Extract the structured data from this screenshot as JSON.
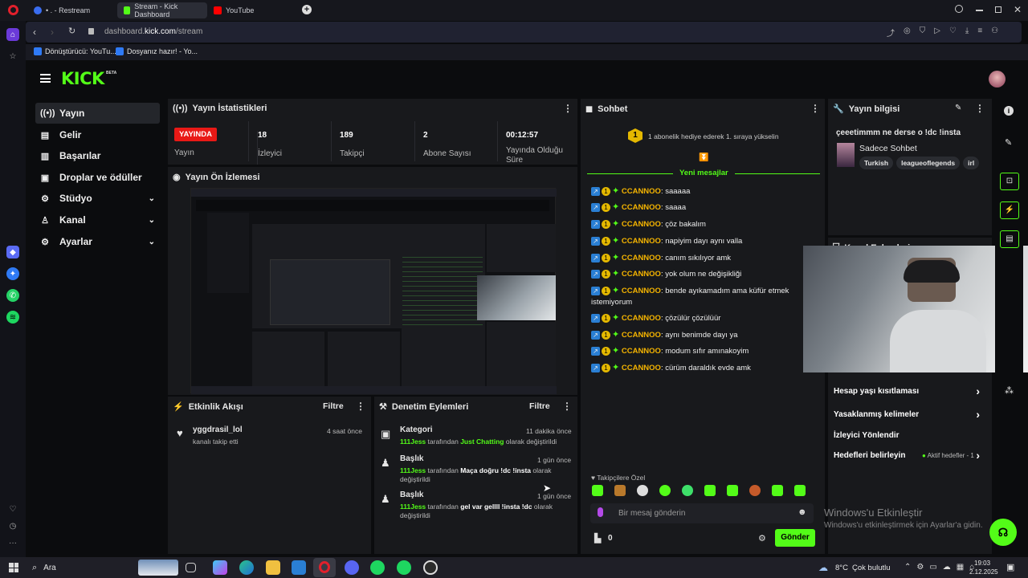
{
  "browser": {
    "tabs": [
      {
        "label": "• . - Restream"
      },
      {
        "label": "Stream - Kick Dashboard"
      },
      {
        "label": "YouTube"
      }
    ],
    "url_prefix": "dashboard.",
    "url_domain": "kick.com",
    "url_path": "/stream",
    "bookmarks": [
      {
        "label": "Dönüştürücü: YouTu..."
      },
      {
        "label": "Dosyanız hazır! - Yo..."
      }
    ]
  },
  "kick": {
    "logo": "KICK",
    "logo_beta": "BETA",
    "nav": [
      {
        "label": "Yayın"
      },
      {
        "label": "Gelir"
      },
      {
        "label": "Başarılar"
      },
      {
        "label": "Droplar ve ödüller"
      },
      {
        "label": "Stüdyo"
      },
      {
        "label": "Kanal"
      },
      {
        "label": "Ayarlar"
      }
    ],
    "stats": {
      "title": "Yayın İstatistikleri",
      "live_badge": "YAYINDA",
      "items": [
        {
          "value": "",
          "label": "Yayın"
        },
        {
          "value": "18",
          "label": "İzleyici"
        },
        {
          "value": "189",
          "label": "Takipçi"
        },
        {
          "value": "2",
          "label": "Abone Sayısı"
        },
        {
          "value": "00:12:57",
          "label": "Yayında Olduğu Süre"
        }
      ]
    },
    "preview": {
      "title": "Yayın Ön İzlemesi"
    },
    "activity": {
      "title": "Etkinlik Akışı",
      "filter": "Filtre",
      "items": [
        {
          "user": "yggdrasil_lol",
          "text": "kanalı takip etti",
          "time": "4 saat önce"
        }
      ]
    },
    "moderation": {
      "title": "Denetim Eylemleri",
      "filter": "Filtre",
      "items": [
        {
          "title": "Kategori",
          "time": "11 dakika önce",
          "user": "111Jess",
          "mid": "tarafından",
          "value": "Just Chatting",
          "suffix": "olarak değiştirildi"
        },
        {
          "title": "Başlık",
          "time": "1 gün önce",
          "user": "111Jess",
          "mid": "tarafından",
          "value": "Maça doğru !dc !insta",
          "suffix": "olarak değiştirildi"
        },
        {
          "title": "Başlık",
          "time": "1 gün önce",
          "user": "111Jess",
          "mid": "tarafından",
          "value": "gel var gellll !insta !dc",
          "suffix": "olarak değiştirildi"
        }
      ]
    },
    "chat": {
      "title": "Sohbet",
      "pinned": "1 abonelik hediye ederek 1. sıraya yükselin",
      "new_messages": "Yeni mesajlar",
      "messages": [
        {
          "user": "CCANNOO",
          "text": "saaaaa"
        },
        {
          "user": "CCANNOO",
          "text": "saaaa"
        },
        {
          "user": "CCANNOO",
          "text": "çöz bakalım"
        },
        {
          "user": "CCANNOO",
          "text": "napiyim dayı aynı valla"
        },
        {
          "user": "CCANNOO",
          "text": "canım sıkılıyor amk"
        },
        {
          "user": "CCANNOO",
          "text": "yok olum ne değişikliği"
        },
        {
          "user": "CCANNOO",
          "text": "bende ayıkamadım ama küfür etmek istemiyorum"
        },
        {
          "user": "CCANNOO",
          "text": "çözülür çözülüür"
        },
        {
          "user": "CCANNOO",
          "text": "aynı benimde dayı ya"
        },
        {
          "user": "CCANNOO",
          "text": "modum sıfır amınakoyim"
        },
        {
          "user": "CCANNOO",
          "text": "cürüm daraldık evde amk"
        }
      ],
      "followers_label": "Takipçilere Özel",
      "input_placeholder": "Bir mesaj gönderin",
      "points": "0",
      "send": "Gönder"
    },
    "stream_info": {
      "title": "Yayın bilgisi",
      "stream_title": "çeeetimmm ne derse o !dc !insta",
      "category": "Sadece Sohbet",
      "tags": [
        "Turkish",
        "leagueoflegends",
        "irl"
      ],
      "channel_actions": "Kanal Eylemleri",
      "actions": [
        {
          "label": "Hesap yaşı kısıtlaması"
        },
        {
          "label": "Yasaklanmış kelimeler"
        },
        {
          "label": "İzleyici Yönlendir"
        },
        {
          "label": "Hedefleri belirleyin",
          "extra": "Aktif hedefler - 1"
        }
      ]
    },
    "watermark": {
      "title": "Windows'u Etkinleştir",
      "subtitle": "Windows'u etkinleştirmek için Ayarlar'a gidin."
    }
  },
  "taskbar": {
    "search": "Ara",
    "weather": "8°C",
    "weather_text": "Çok bulutlu",
    "time": "19:03",
    "date": "2.12.2025"
  },
  "colors": {
    "kick_green": "#53fc18",
    "username": "#f5b400",
    "live_red": "#e91916"
  }
}
